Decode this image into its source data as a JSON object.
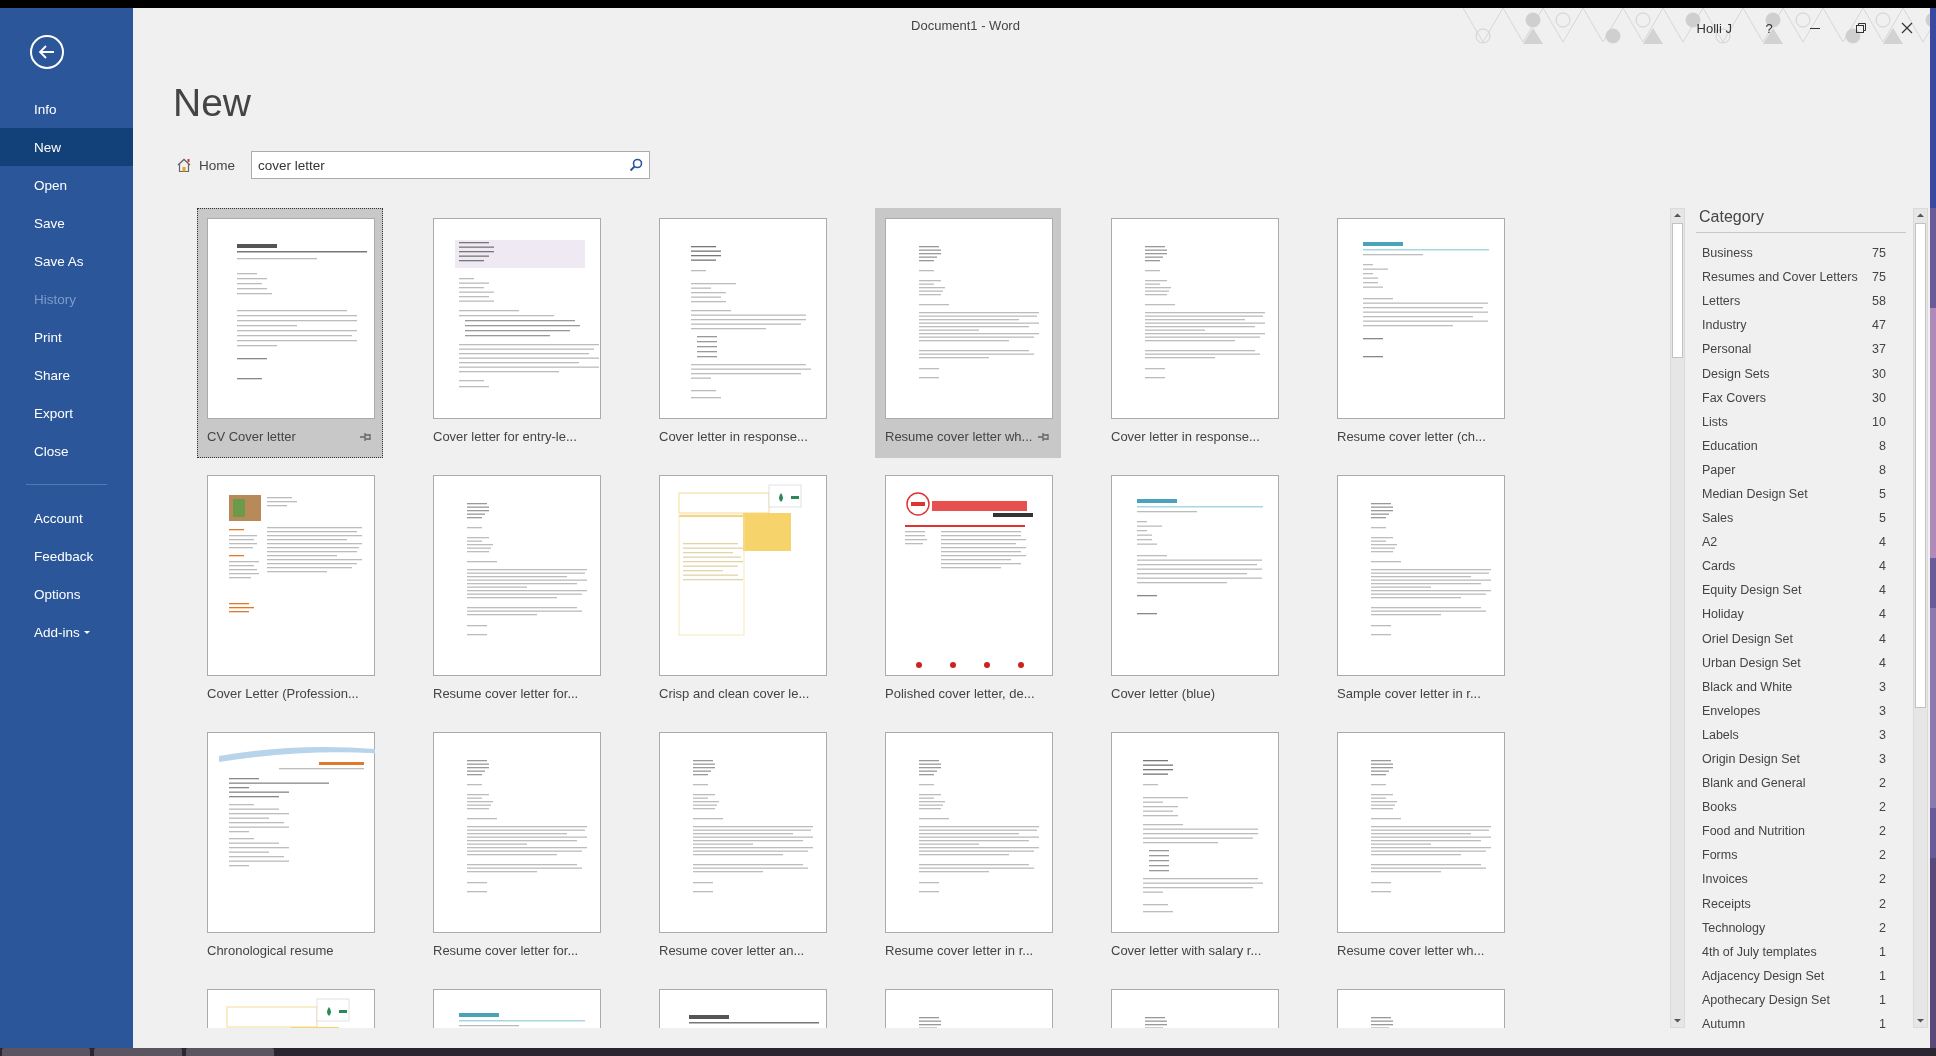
{
  "window": {
    "title": "Document1  -  Word",
    "user": "Holli J",
    "help": "?"
  },
  "sidebar": {
    "items": [
      {
        "label": "Info",
        "selected": false,
        "disabled": false
      },
      {
        "label": "New",
        "selected": true,
        "disabled": false
      },
      {
        "label": "Open",
        "selected": false,
        "disabled": false
      },
      {
        "label": "Save",
        "selected": false,
        "disabled": false
      },
      {
        "label": "Save As",
        "selected": false,
        "disabled": false
      },
      {
        "label": "History",
        "selected": false,
        "disabled": true
      },
      {
        "label": "Print",
        "selected": false,
        "disabled": false
      },
      {
        "label": "Share",
        "selected": false,
        "disabled": false
      },
      {
        "label": "Export",
        "selected": false,
        "disabled": false
      },
      {
        "label": "Close",
        "selected": false,
        "disabled": false
      }
    ],
    "footer_items": [
      {
        "label": "Account",
        "dropdown": false
      },
      {
        "label": "Feedback",
        "dropdown": false
      },
      {
        "label": "Options",
        "dropdown": false
      },
      {
        "label": "Add-ins",
        "dropdown": true
      }
    ]
  },
  "page_title": "New",
  "breadcrumb": "Home",
  "search": {
    "value": "cover letter"
  },
  "templates": [
    {
      "label": "CV Cover letter",
      "kind": "heading",
      "selected": true,
      "hovered": false
    },
    {
      "label": "Cover letter for entry-le...",
      "kind": "band",
      "selected": false,
      "hovered": false
    },
    {
      "label": "Cover letter in response...",
      "kind": "plain",
      "selected": false,
      "hovered": false
    },
    {
      "label": "Resume cover letter wh...",
      "kind": "small",
      "selected": false,
      "hovered": true
    },
    {
      "label": "Cover letter in response...",
      "kind": "small",
      "selected": false,
      "hovered": false
    },
    {
      "label": "Resume cover letter (ch...",
      "kind": "blue",
      "selected": false,
      "hovered": false
    },
    {
      "label": "Cover Letter (Profession...",
      "selected": false,
      "hovered": false
    },
    {
      "label": "Resume cover letter for...",
      "kind": "small",
      "selected": false,
      "hovered": false
    },
    {
      "label": "Crisp and clean cover le...",
      "kind": "moo",
      "selected": false,
      "hovered": false
    },
    {
      "label": "Polished cover letter, de...",
      "kind": "red",
      "selected": false,
      "hovered": false
    },
    {
      "label": "Cover letter (blue)",
      "kind": "blue",
      "selected": false,
      "hovered": false
    },
    {
      "label": "Sample cover letter in r...",
      "kind": "small",
      "selected": false,
      "hovered": false
    },
    {
      "label": "Chronological resume",
      "kind": "swoosh",
      "selected": false,
      "hovered": false
    },
    {
      "label": "Resume cover letter for...",
      "kind": "small",
      "selected": false,
      "hovered": false
    },
    {
      "label": "Resume cover letter an...",
      "kind": "small",
      "selected": false,
      "hovered": false
    },
    {
      "label": "Resume cover letter in r...",
      "kind": "small",
      "selected": false,
      "hovered": false
    },
    {
      "label": "Cover letter with salary r...",
      "kind": "plain",
      "selected": false,
      "hovered": false
    },
    {
      "label": "Resume cover letter wh...",
      "kind": "small",
      "selected": false,
      "hovered": false
    },
    {
      "kind": "moo",
      "selected": false,
      "hovered": false
    },
    {
      "kind": "blue",
      "selected": false,
      "hovered": false
    },
    {
      "kind": "heading",
      "selected": false,
      "hovered": false
    },
    {
      "kind": "small",
      "selected": false,
      "hovered": false
    },
    {
      "kind": "small",
      "selected": false,
      "hovered": false
    },
    {
      "kind": "small",
      "selected": false,
      "hovered": false
    }
  ],
  "category": {
    "title": "Category",
    "items": [
      {
        "name": "Business",
        "count": "75"
      },
      {
        "name": "Resumes and Cover Letters",
        "count": "75"
      },
      {
        "name": "Letters",
        "count": "58"
      },
      {
        "name": "Industry",
        "count": "47"
      },
      {
        "name": "Personal",
        "count": "37"
      },
      {
        "name": "Design Sets",
        "count": "30"
      },
      {
        "name": "Fax Covers",
        "count": "30"
      },
      {
        "name": "Lists",
        "count": "10"
      },
      {
        "name": "Education",
        "count": "8"
      },
      {
        "name": "Paper",
        "count": "8"
      },
      {
        "name": "Median Design Set",
        "count": "5"
      },
      {
        "name": "Sales",
        "count": "5"
      },
      {
        "name": "A2",
        "count": "4"
      },
      {
        "name": "Cards",
        "count": "4"
      },
      {
        "name": "Equity Design Set",
        "count": "4"
      },
      {
        "name": "Holiday",
        "count": "4"
      },
      {
        "name": "Oriel Design Set",
        "count": "4"
      },
      {
        "name": "Urban Design Set",
        "count": "4"
      },
      {
        "name": "Black and White",
        "count": "3"
      },
      {
        "name": "Envelopes",
        "count": "3"
      },
      {
        "name": "Labels",
        "count": "3"
      },
      {
        "name": "Origin Design Set",
        "count": "3"
      },
      {
        "name": "Blank and General",
        "count": "2"
      },
      {
        "name": "Books",
        "count": "2"
      },
      {
        "name": "Food and Nutrition",
        "count": "2"
      },
      {
        "name": "Forms",
        "count": "2"
      },
      {
        "name": "Invoices",
        "count": "2"
      },
      {
        "name": "Receipts",
        "count": "2"
      },
      {
        "name": "Technology",
        "count": "2"
      },
      {
        "name": "4th of July templates",
        "count": "1"
      },
      {
        "name": "Adjacency Design Set",
        "count": "1"
      },
      {
        "name": "Apothecary Design Set",
        "count": "1"
      },
      {
        "name": "Autumn",
        "count": "1"
      }
    ]
  }
}
